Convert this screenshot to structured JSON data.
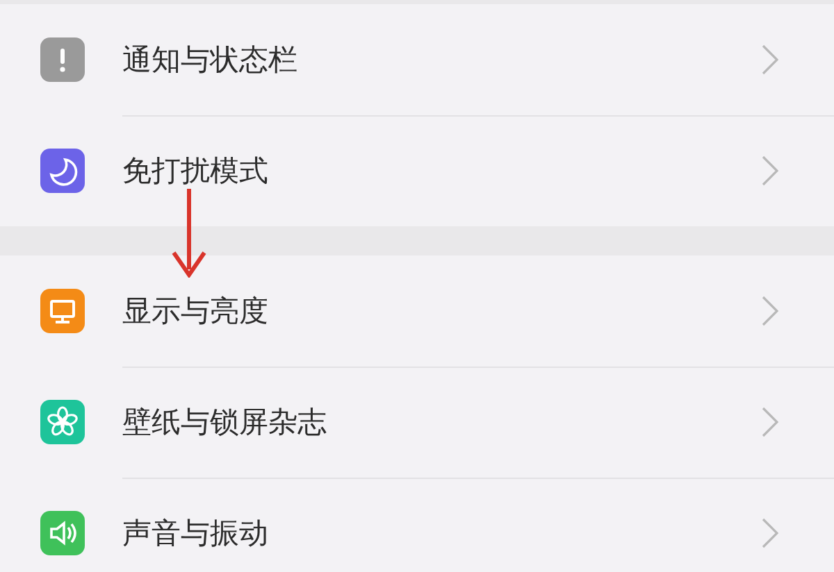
{
  "groups": [
    {
      "items": [
        {
          "label": "通知与状态栏",
          "kind": "notice",
          "color": "#9a9a9a"
        },
        {
          "label": "免打扰模式",
          "kind": "moon",
          "color": "#6c63e8"
        }
      ]
    },
    {
      "items": [
        {
          "label": "显示与亮度",
          "kind": "display",
          "color": "#f48b16"
        },
        {
          "label": "壁纸与锁屏杂志",
          "kind": "flower",
          "color": "#1ec49a"
        },
        {
          "label": "声音与振动",
          "kind": "sound",
          "color": "#3fc15a"
        }
      ]
    }
  ]
}
